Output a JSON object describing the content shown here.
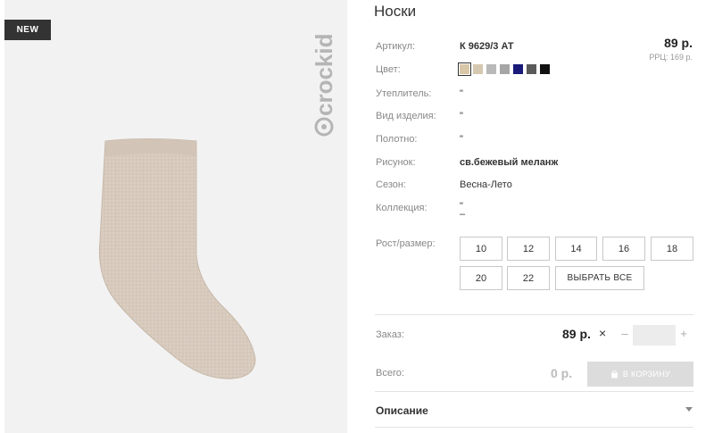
{
  "badge": "NEW",
  "brand": "crockid",
  "product": {
    "title": "Носки",
    "price": "89 р.",
    "rrp": "РРЦ: 169 р."
  },
  "attributes": [
    {
      "label": "Артикул:",
      "value": "К 9629/3 АТ"
    },
    {
      "label": "Цвет:",
      "value": ""
    },
    {
      "label": "Утеплитель:",
      "value": "\""
    },
    {
      "label": "Вид изделия:",
      "value": "\""
    },
    {
      "label": "Полотно:",
      "value": "\""
    },
    {
      "label": "Рисунок:",
      "value": "св.бежевый меланж"
    },
    {
      "label": "Сезон:",
      "value": "Весна-Лето"
    },
    {
      "label": "Коллекция:",
      "value": "\"\n–"
    }
  ],
  "colors": [
    "#d9c7a8",
    "#d6c8b0",
    "#b9b9b9",
    "#a6a6a6",
    "#1a1a7a",
    "#5a5a5a",
    "#111111"
  ],
  "size_label": "Рост/размер:",
  "sizes": [
    "10",
    "12",
    "14",
    "16",
    "18",
    "20",
    "22"
  ],
  "select_all": "ВЫБРАТЬ ВСЕ",
  "order": {
    "label": "Заказ:",
    "price": "89 р.",
    "times": "×",
    "minus": "–",
    "qty": "",
    "plus": "+"
  },
  "total": {
    "label": "Всего:",
    "value": "0 р.",
    "cart_button": "В КОРЗИНУ"
  },
  "description": {
    "label": "Описание"
  },
  "icons": {
    "times": "times-icon",
    "cart": "shopping-bag-icon",
    "chevron": "chevron-down-icon"
  }
}
